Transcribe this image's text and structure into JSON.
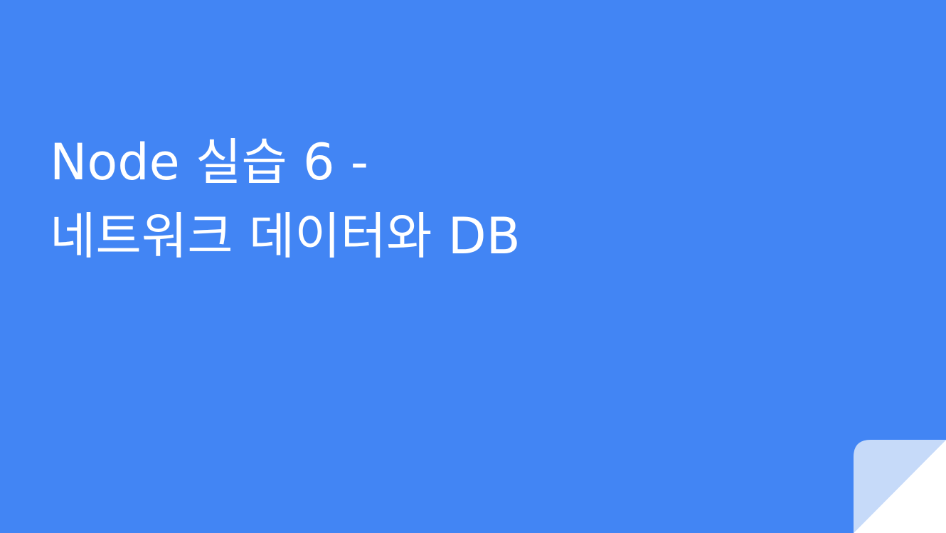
{
  "slide": {
    "title_lines": [
      "Node 실습 6 -",
      "네트워크 데이터와 DB"
    ],
    "background_color": "#4285f4",
    "corner_fold_color": "#c6daf9",
    "corner_fold_icon": "page-curl-icon"
  }
}
